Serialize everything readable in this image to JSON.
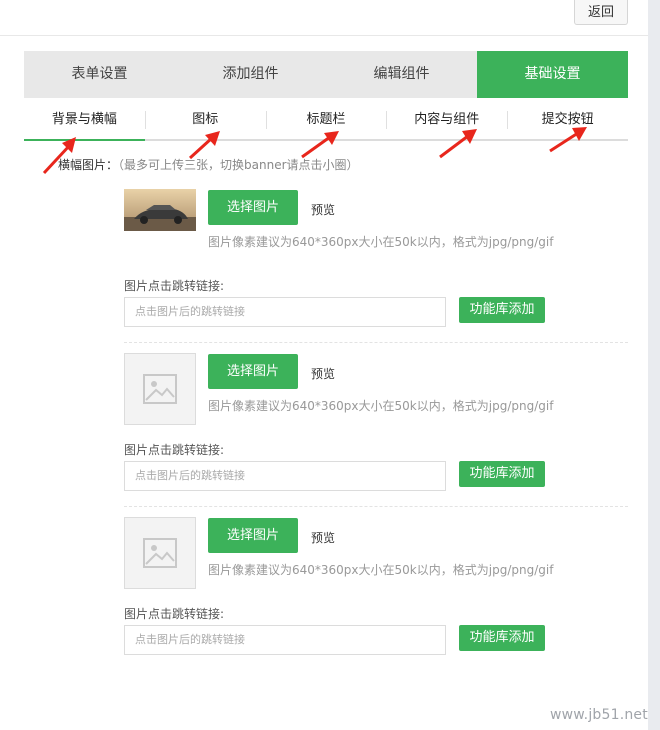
{
  "toolbar": {
    "back_label": "返回"
  },
  "tabs": [
    {
      "label": "表单设置"
    },
    {
      "label": "添加组件"
    },
    {
      "label": "编辑组件"
    },
    {
      "label": "基础设置"
    }
  ],
  "subtabs": [
    {
      "label": "背景与横幅"
    },
    {
      "label": "图标"
    },
    {
      "label": "标题栏"
    },
    {
      "label": "内容与组件"
    },
    {
      "label": "提交按钮"
    }
  ],
  "banner": {
    "label": "横幅图片：",
    "hint": "（最多可上传三张，切换banner请点击小圈）",
    "items": [
      {
        "select_label": "选择图片",
        "preview_label": "预览",
        "size_hint": "图片像素建议为640*360px大小在50k以内，格式为jpg/png/gif",
        "link_label": "图片点击跳转链接:",
        "link_placeholder": "点击图片后的跳转链接",
        "library_label": "功能库添加"
      },
      {
        "select_label": "选择图片",
        "preview_label": "预览",
        "size_hint": "图片像素建议为640*360px大小在50k以内，格式为jpg/png/gif",
        "link_label": "图片点击跳转链接:",
        "link_placeholder": "点击图片后的跳转链接",
        "library_label": "功能库添加"
      },
      {
        "select_label": "选择图片",
        "preview_label": "预览",
        "size_hint": "图片像素建议为640*360px大小在50k以内，格式为jpg/png/gif",
        "link_label": "图片点击跳转链接:",
        "link_placeholder": "点击图片后的跳转链接",
        "library_label": "功能库添加"
      }
    ]
  },
  "watermark": "www.jb51.net",
  "colors": {
    "accent": "#3cb25a",
    "arrow": "#e8261c",
    "tab_bg": "#e8e8e8"
  }
}
